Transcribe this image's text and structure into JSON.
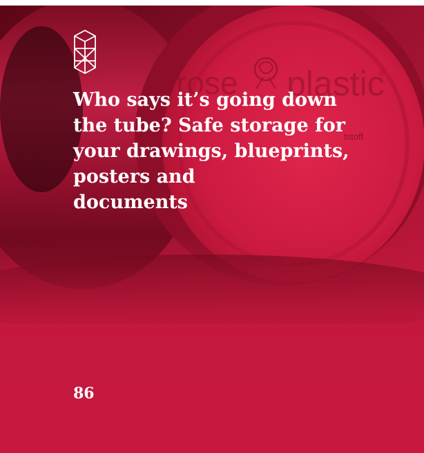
{
  "headline": "Who says it’s going down\nthe tube? Safe storage for\nyour drawings, blueprints,\nposters and\ndocuments",
  "page_number": "86",
  "brand": {
    "logo_icon": "cube-wireframe-icon",
    "product_print": "rose plastic",
    "product_print_fragment": "tstoff"
  },
  "colors": {
    "accent": "#c4183e",
    "text": "#ffffff"
  }
}
